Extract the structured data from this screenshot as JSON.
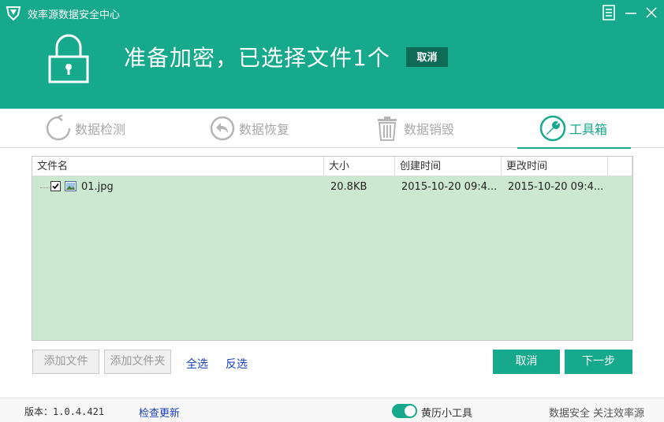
{
  "window": {
    "title": "效率源数据安全中心",
    "menu_icon": "menu-icon",
    "minimize_icon": "minimize-icon",
    "close_icon": "close-icon"
  },
  "hero": {
    "message": "准备加密，已选择文件1个",
    "cancel_label": "取消",
    "icon": "lock-icon"
  },
  "tabs": [
    {
      "label": "数据检测",
      "icon": "refresh-circle-icon",
      "active": false
    },
    {
      "label": "数据恢复",
      "icon": "undo-arrow-icon",
      "active": false
    },
    {
      "label": "数据销毁",
      "icon": "trash-icon",
      "active": false
    },
    {
      "label": "工具箱",
      "icon": "wrench-icon",
      "active": true
    }
  ],
  "file_list": {
    "columns": [
      "文件名",
      "大小",
      "创建时间",
      "更改时间"
    ],
    "rows": [
      {
        "checked": true,
        "name": "01.jpg",
        "size": "20.8KB",
        "created": "2015-10-20 09:4...",
        "modified": "2015-10-20 09:4..."
      }
    ]
  },
  "actions": {
    "add_file": "添加文件",
    "add_folder": "添加文件夹",
    "select_all": "全选",
    "invert_select": "反选",
    "cancel": "取消",
    "next": "下一步"
  },
  "footer": {
    "version": "版本：1.0.4.421",
    "check_update": "检查更新",
    "calendar_tool": "黄历小工具",
    "calendar_toggle_on": true,
    "slogan": "数据安全 关注效率源"
  },
  "colors": {
    "brand": "#16a98c",
    "brand_dark": "#0e6b55",
    "list_bg": "#cde8d0",
    "link": "#1a3fbf"
  }
}
